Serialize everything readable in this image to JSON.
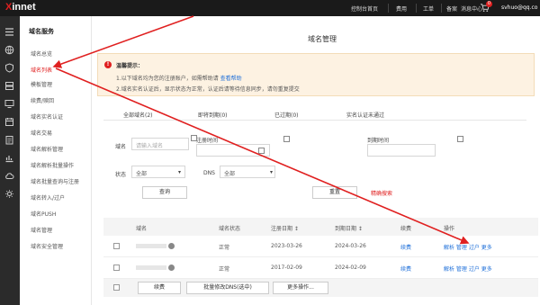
{
  "header": {
    "logo_main": "X",
    "logo_rest": "innet",
    "nav": [
      "控制台首页",
      "费用",
      "工单",
      "备案",
      "消息中心"
    ],
    "cart_count": "0",
    "user": "svhuo@qq.co"
  },
  "sidebar": {
    "heading": "域名服务",
    "items": [
      {
        "label": "域名总览",
        "active": false
      },
      {
        "label": "域名列表",
        "active": true
      },
      {
        "label": "模板管理",
        "active": false
      },
      {
        "label": "续费/赎回",
        "active": false
      },
      {
        "label": "域名实名认证",
        "active": false
      },
      {
        "label": "域名交易",
        "active": false
      },
      {
        "label": "域名解析管理",
        "active": false
      },
      {
        "label": "域名解析批量操作",
        "active": false
      },
      {
        "label": "域名批量查询与注册",
        "active": false
      },
      {
        "label": "域名转入/过户",
        "active": false
      },
      {
        "label": "域名PUSH",
        "active": false
      },
      {
        "label": "域名管理",
        "active": false
      },
      {
        "label": "域名安全管理",
        "active": false
      }
    ]
  },
  "page": {
    "title": "域名管理"
  },
  "notice": {
    "title": "温馨提示：",
    "line1": "1.以下域名均为您的注册账户，如需帮助请",
    "line1_link": "查看帮助",
    "line2": "2.域名实名认证后，显示状态为正常，认证后请等待信息同步，请勿重复提交"
  },
  "filter_tabs": [
    "全部域名(2)",
    "即将到期(0)",
    "已过期(0)",
    "实名认证未通过"
  ],
  "filters": {
    "domain_label": "域名",
    "domain_placeholder": "请输入域名",
    "reg_time_label": "注册时间",
    "expire_time_label": "到期时间",
    "status_label": "状态",
    "status_value": "全部",
    "dns_label": "DNS",
    "dns_value": "全部",
    "search_button": "查询",
    "reset_button": "重置",
    "advanced_link": "精确搜索"
  },
  "table": {
    "headers": [
      "域名",
      "域名状态",
      "注册日期 ↕",
      "到期日期 ↕",
      "续费",
      "操作"
    ],
    "rows": [
      {
        "status": "正常",
        "reg_date": "2023-03-26",
        "exp_date": "2024-03-26",
        "renew": "续费",
        "actions": "解析 管理 过户 更多"
      },
      {
        "status": "正常",
        "reg_date": "2017-02-09",
        "exp_date": "2024-02-09",
        "renew": "续费",
        "actions": "解析 管理 过户 更多"
      }
    ]
  },
  "footer": {
    "buttons": [
      "续费",
      "批量修改DNS(选中)",
      "更多操作..."
    ]
  },
  "colors": {
    "topbar": "#1a1a1a",
    "iconbar": "#2b2b2b",
    "accent_red": "#e02020",
    "link_blue": "#1e6fd9",
    "notice_bg": "#fdf2e2"
  },
  "icons": [
    "menu-icon",
    "globe-icon",
    "shield-icon",
    "server-icon",
    "monitor-icon",
    "calendar-icon",
    "clipboard-icon",
    "chart-icon",
    "cloud-icon",
    "gear-icon"
  ]
}
